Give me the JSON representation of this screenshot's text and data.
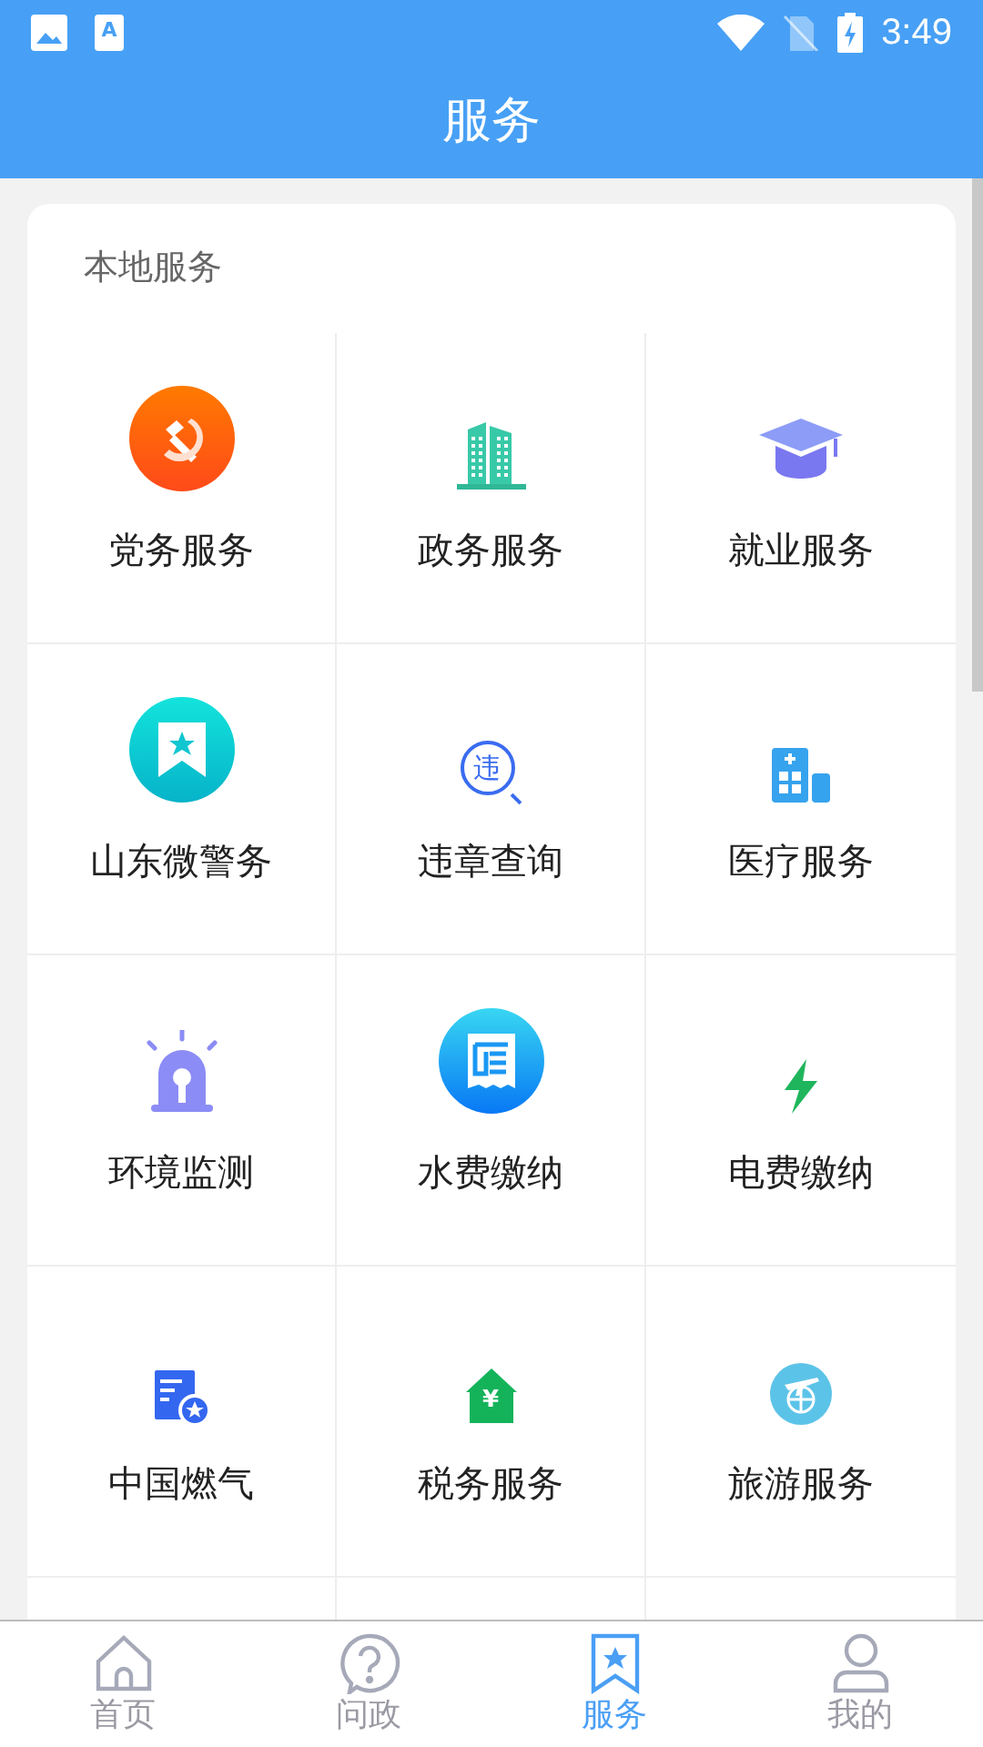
{
  "status_bar": {
    "app_badge": "A",
    "time": "3:49"
  },
  "header": {
    "title": "服务"
  },
  "section": {
    "title": "本地服务",
    "items": [
      {
        "label": "党务服务",
        "kind": "party"
      },
      {
        "label": "政务服务",
        "kind": "building"
      },
      {
        "label": "就业服务",
        "kind": "graduation"
      },
      {
        "label": "山东微警务",
        "kind": "police"
      },
      {
        "label": "违章查询",
        "kind": "violation",
        "icon_text": "违"
      },
      {
        "label": "医疗服务",
        "kind": "hospital"
      },
      {
        "label": "环境监测",
        "kind": "alarm"
      },
      {
        "label": "水费缴纳",
        "kind": "water"
      },
      {
        "label": "电费缴纳",
        "kind": "electric"
      },
      {
        "label": "中国燃气",
        "kind": "gas"
      },
      {
        "label": "税务服务",
        "kind": "tax",
        "icon_text": "¥"
      },
      {
        "label": "旅游服务",
        "kind": "travel"
      }
    ]
  },
  "tabs": [
    {
      "label": "首页",
      "kind": "home",
      "selected": false
    },
    {
      "label": "问政",
      "kind": "question",
      "selected": false
    },
    {
      "label": "服务",
      "kind": "bookmark",
      "selected": true
    },
    {
      "label": "我的",
      "kind": "user",
      "selected": false
    }
  ]
}
